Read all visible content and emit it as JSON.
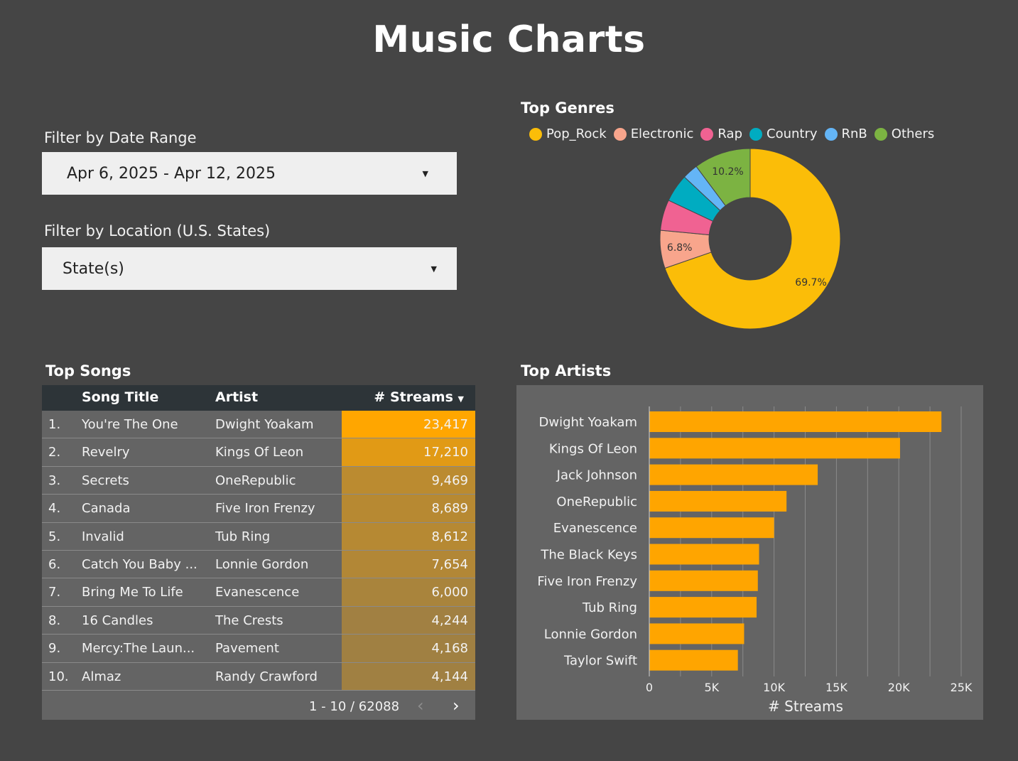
{
  "page": {
    "title": "Music Charts"
  },
  "filters": {
    "date_label": "Filter by Date Range",
    "date_value": "Apr 6, 2025 - Apr 12, 2025",
    "location_label": "Filter by Location (U.S. States)",
    "location_value": "State(s)"
  },
  "genres": {
    "title": "Top Genres",
    "legend": [
      {
        "name": "Pop_Rock",
        "color": "#fbbd08"
      },
      {
        "name": "Electronic",
        "color": "#f8a58c"
      },
      {
        "name": "Rap",
        "color": "#f06292"
      },
      {
        "name": "Country",
        "color": "#00acc1"
      },
      {
        "name": "RnB",
        "color": "#64b5f6"
      },
      {
        "name": "Others",
        "color": "#7cb342"
      }
    ]
  },
  "chart_data": [
    {
      "type": "pie",
      "title": "Top Genres",
      "categories": [
        "Pop_Rock",
        "Electronic",
        "Rap",
        "Country",
        "RnB",
        "Others"
      ],
      "values": [
        69.7,
        6.8,
        5.5,
        5.0,
        2.8,
        10.2
      ],
      "labels_shown": [
        "69.7%",
        "6.8%",
        "",
        "",
        "",
        "10.2%"
      ],
      "legend_position": "top"
    },
    {
      "type": "bar",
      "orientation": "horizontal",
      "title": "Top Artists",
      "categories": [
        "Dwight Yoakam",
        "Kings Of Leon",
        "Jack Johnson",
        "OneRepublic",
        "Evanescence",
        "The Black Keys",
        "Five Iron Frenzy",
        "Tub Ring",
        "Lonnie Gordon",
        "Taylor Swift"
      ],
      "values": [
        23417,
        20100,
        13500,
        11000,
        10000,
        8800,
        8700,
        8600,
        7600,
        7100
      ],
      "xlabel": "# Streams",
      "xlim": [
        0,
        25000
      ],
      "xticks": [
        "0",
        "5K",
        "10K",
        "15K",
        "20K",
        "25K"
      ],
      "grid": true
    }
  ],
  "songs": {
    "title": "Top Songs",
    "headers": {
      "title": "Song Title",
      "artist": "Artist",
      "streams": "# Streams"
    },
    "rows": [
      {
        "rank": "1.",
        "title": "You're The One",
        "artist": "Dwight Yoakam",
        "streams": "23,417",
        "value": 23417
      },
      {
        "rank": "2.",
        "title": "Revelry",
        "artist": "Kings Of Leon",
        "streams": "17,210",
        "value": 17210
      },
      {
        "rank": "3.",
        "title": "Secrets",
        "artist": "OneRepublic",
        "streams": "9,469",
        "value": 9469
      },
      {
        "rank": "4.",
        "title": "Canada",
        "artist": "Five Iron Frenzy",
        "streams": "8,689",
        "value": 8689
      },
      {
        "rank": "5.",
        "title": "Invalid",
        "artist": "Tub Ring",
        "streams": "8,612",
        "value": 8612
      },
      {
        "rank": "6.",
        "title": "Catch You Baby ...",
        "artist": "Lonnie Gordon",
        "streams": "7,654",
        "value": 7654
      },
      {
        "rank": "7.",
        "title": "Bring Me To Life",
        "artist": "Evanescence",
        "streams": "6,000",
        "value": 6000
      },
      {
        "rank": "8.",
        "title": "16 Candles",
        "artist": "The Crests",
        "streams": "4,244",
        "value": 4244
      },
      {
        "rank": "9.",
        "title": "Mercy:The Laun...",
        "artist": "Pavement",
        "streams": "4,168",
        "value": 4168
      },
      {
        "rank": "10.",
        "title": "Almaz",
        "artist": "Randy Crawford",
        "streams": "4,144",
        "value": 4144
      }
    ],
    "pager": "1 - 10 / 62088"
  },
  "artists": {
    "title": "Top Artists",
    "bar_color": "#ffa500"
  }
}
